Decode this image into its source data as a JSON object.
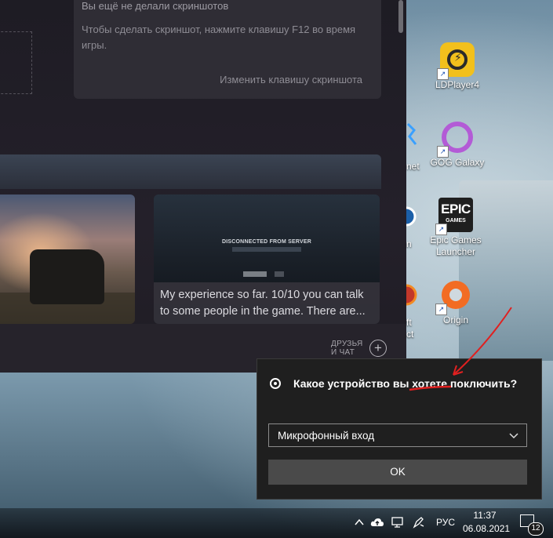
{
  "steam": {
    "screenshots": {
      "no_screenshots": "Вы ещё не делали скриншотов",
      "hint": "Чтобы сделать скриншот, нажмите клавишу F12 во время игры.",
      "change_key": "Изменить клавишу скриншота"
    },
    "thumbnails": {
      "disconnected_title": "DISCONNECTED FROM SERVER",
      "caption": "My experience so far. 10/10 you can talk to some people in the game. There are..."
    },
    "friends": {
      "label": "ДРУЗЬЯ\nИ ЧАТ",
      "plus": "+"
    }
  },
  "desktop_icons": [
    {
      "label": "LDPlayer4",
      "icon": "ldplayer-icon"
    },
    {
      "label": "GOG Galaxy",
      "icon": "gog-galaxy-icon"
    },
    {
      "label": "Epic Games Launcher",
      "icon": "epic-games-icon",
      "logo_top": "EPIC",
      "logo_bottom": "GAMES"
    },
    {
      "label": "Origin",
      "icon": "origin-icon"
    }
  ],
  "partial_labels": [
    "net",
    "n",
    "ft",
    "ct"
  ],
  "popup": {
    "message": "Какое устройство вы хотете поключить?",
    "select_value": "Микрофонный вход",
    "ok_label": "OK"
  },
  "taskbar": {
    "language": "РУС",
    "time": "11:37",
    "date": "06.08.2021",
    "notification_count": "12"
  },
  "colors": {
    "popup_bg": "#1f1f1f",
    "ok_button": "#4a4a4a",
    "annotation": "#e02020"
  }
}
